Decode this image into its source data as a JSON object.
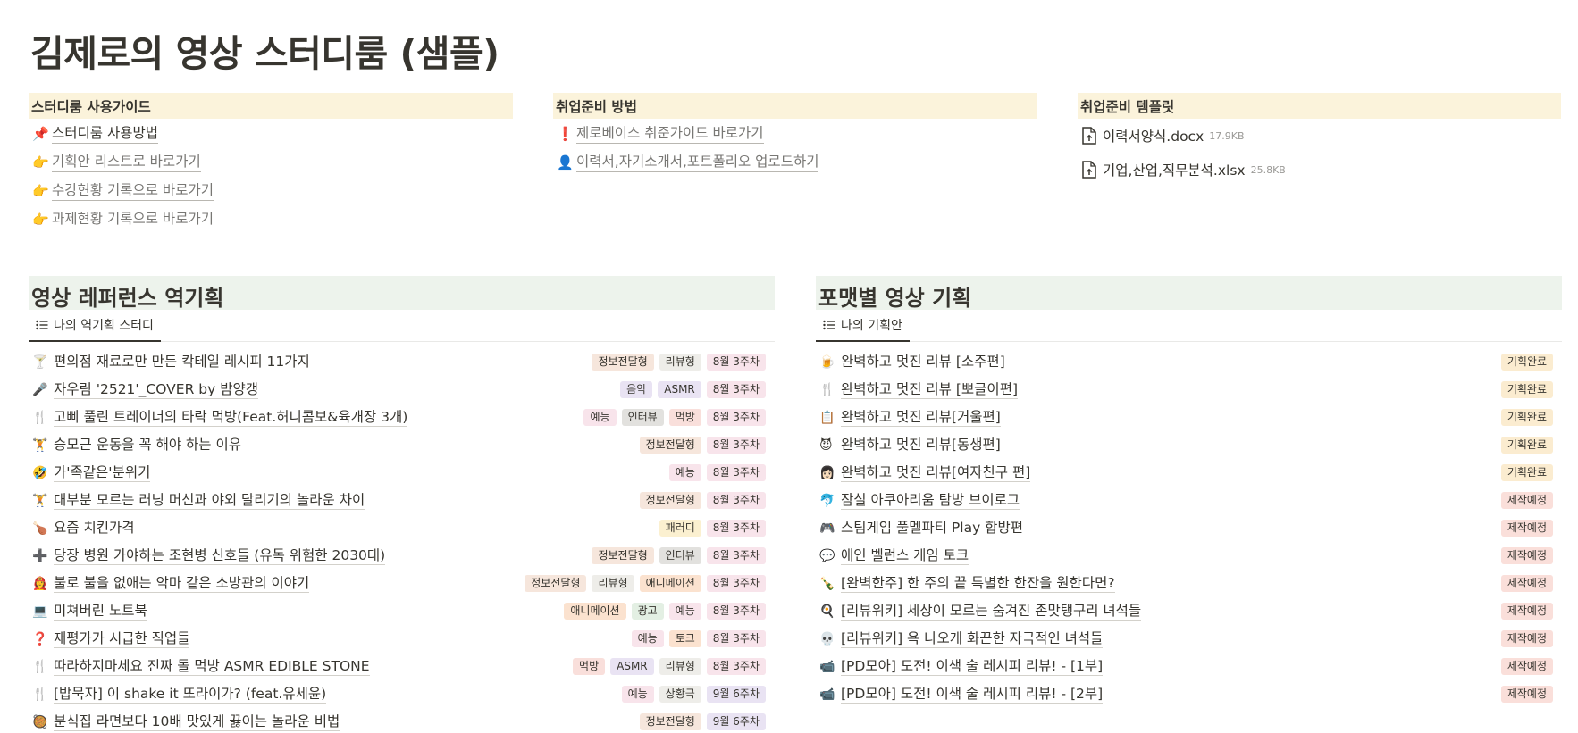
{
  "page": {
    "title": "김제로의 영상 스터디룸 (샘플)"
  },
  "guide": {
    "header": "스터디룸 사용가이드",
    "links": [
      {
        "icon": "📌",
        "icon_name": "pushpin-icon",
        "label": "스터디룸 사용방법",
        "muted": false
      },
      {
        "icon": "👉",
        "icon_name": "pointing-hand-icon",
        "label": "기획안 리스트로 바로가기",
        "muted": true
      },
      {
        "icon": "👉",
        "icon_name": "pointing-hand-icon",
        "label": "수강현황 기록으로 바로가기",
        "muted": true
      },
      {
        "icon": "👉",
        "icon_name": "pointing-hand-icon",
        "label": "과제현황 기록으로 바로가기",
        "muted": true
      }
    ]
  },
  "job": {
    "header": "취업준비 방법",
    "links": [
      {
        "icon": "❗",
        "icon_name": "exclamation-icon",
        "label": "제로베이스 취준가이드 바로가기",
        "muted": true
      },
      {
        "icon": "👤",
        "icon_name": "user-icon",
        "label": "이력서,자기소개서,포트폴리오 업로드하기",
        "muted": true
      }
    ]
  },
  "templates": {
    "header": "취업준비 템플릿",
    "files": [
      {
        "name": "이력서양식.docx",
        "size": "17.9KB",
        "icon_name": "file-upload-icon"
      },
      {
        "name": "기업,산업,직무분석.xlsx",
        "size": "25.8KB",
        "icon_name": "file-upload-icon"
      }
    ]
  },
  "colors": {
    "정보전달형": "#f6e6dc",
    "리뷰형": "#eeede9",
    "8월 3주차": "#f8e4eb",
    "9월 6주차": "#e9e3f3",
    "음악": "#e9e3f3",
    "ASMR": "#e9e3f3",
    "예능": "#f8e4eb",
    "인터뷰": "#e2e1de",
    "먹방": "#f9dfdb",
    "패러디": "#fbf0d0",
    "애니메이션": "#fbe2cf",
    "광고": "#e3efe3",
    "토크": "#fbe2cf",
    "상황극": "#eeede9",
    "기획완료": "#fbecd0",
    "제작예정": "#fadfda"
  },
  "references": {
    "header": "영상 레퍼런스 역기획",
    "view_label": "나의 역기획 스터디",
    "rows": [
      {
        "icon": "🍸",
        "title": "편의점 재료로만 만든 칵테일 레시피 11가지",
        "tags": [
          "정보전달형",
          "리뷰형",
          "8월 3주차"
        ]
      },
      {
        "icon": "🎤",
        "title": "자우림 '2521'_COVER by 밤양갱",
        "tags": [
          "음악",
          "ASMR",
          "8월 3주차"
        ]
      },
      {
        "icon": "🍴",
        "title": "고삐 풀린 트레이너의 타락 먹방(Feat.허니콤보&육개장 3개)",
        "tags": [
          "예능",
          "인터뷰",
          "먹방",
          "8월 3주차"
        ]
      },
      {
        "icon": "🏋",
        "title": "승모근 운동을 꼭 해야 하는 이유",
        "tags": [
          "정보전달형",
          "8월 3주차"
        ]
      },
      {
        "icon": "🤣",
        "title": "가'족같은'분위기",
        "tags": [
          "예능",
          "8월 3주차"
        ]
      },
      {
        "icon": "🏋",
        "title": "대부분 모르는 러닝 머신과 야외 달리기의 놀라운 차이",
        "tags": [
          "정보전달형",
          "8월 3주차"
        ]
      },
      {
        "icon": "🍗",
        "title": "요즘 치킨가격",
        "tags": [
          "패러디",
          "8월 3주차"
        ]
      },
      {
        "icon": "➕",
        "title": "당장 병원 가야하는 조현병 신호들 (유독 위험한 2030대)",
        "tags": [
          "정보전달형",
          "인터뷰",
          "8월 3주차"
        ]
      },
      {
        "icon": "👩‍🚒",
        "title": "불로 불을 없애는 악마 같은 소방관의 이야기",
        "tags": [
          "정보전달형",
          "리뷰형",
          "애니메이션",
          "8월 3주차"
        ]
      },
      {
        "icon": "💻",
        "title": "미쳐버린 노트북",
        "tags": [
          "애니메이션",
          "광고",
          "예능",
          "8월 3주차"
        ]
      },
      {
        "icon": "❓",
        "title": "재평가가 시급한 직업들",
        "tags": [
          "예능",
          "토크",
          "8월 3주차"
        ]
      },
      {
        "icon": "🍴",
        "title": "따라하지마세요 진짜 돌 먹방 ASMR EDIBLE STONE",
        "tags": [
          "먹방",
          "ASMR",
          "리뷰형",
          "8월 3주차"
        ]
      },
      {
        "icon": "🍴",
        "title": "[밥묵자] 이 shake it 또라이가? (feat.유세윤)",
        "tags": [
          "예능",
          "상황극",
          "9월 6주차"
        ]
      },
      {
        "icon": "🥘",
        "title": "분식집 라면보다 10배 맛있게 끓이는 놀라운 비법",
        "tags": [
          "정보전달형",
          "9월 6주차"
        ]
      }
    ]
  },
  "formats": {
    "header": "포맷별 영상 기획",
    "view_label": "나의 기획안",
    "rows": [
      {
        "icon": "🍺",
        "title": "완벽하고 멋진 리뷰 [소주편]",
        "tags": [
          "기획완료"
        ]
      },
      {
        "icon": "🍴",
        "title": "완벽하고 멋진 리뷰 [뽀글이편]",
        "tags": [
          "기획완료"
        ]
      },
      {
        "icon": "📋",
        "title": "완벽하고 멋진 리뷰[거울편]",
        "tags": [
          "기획완료"
        ]
      },
      {
        "icon": "😈",
        "title": "완벽하고 멋진 리뷰[동생편]",
        "tags": [
          "기획완료"
        ]
      },
      {
        "icon": "👩🏻",
        "title": "완벽하고 멋진 리뷰[여자친구 편]",
        "tags": [
          "기획완료"
        ]
      },
      {
        "icon": "🐬",
        "title": "잠실 아쿠아리움 탐방 브이로그",
        "tags": [
          "제작예정"
        ]
      },
      {
        "icon": "🎮",
        "title": "스팀게임 풀멜파티 Play 합방편",
        "tags": [
          "제작예정"
        ]
      },
      {
        "icon": "💬",
        "title": "애인 벨런스 게임 토크",
        "tags": [
          "제작예정"
        ]
      },
      {
        "icon": "🍾",
        "title": "[완벽한주] 한 주의 끝 특별한 한잔을 원한다면?",
        "tags": [
          "제작예정"
        ]
      },
      {
        "icon": "🍳",
        "title": "[리뷰위키] 세상이 모르는 숨겨진 존맛탱구리 녀석들",
        "tags": [
          "제작예정"
        ]
      },
      {
        "icon": "💀",
        "title": "[리뷰위키] 욕 나오게 화끈한 자극적인 녀석들",
        "tags": [
          "제작예정"
        ]
      },
      {
        "icon": "📹",
        "title": "[PD모아] 도전! 이색 술 레시피 리뷰! - [1부]",
        "tags": [
          "제작예정"
        ]
      },
      {
        "icon": "📹",
        "title": "[PD모아] 도전! 이색 술 레시피 리뷰! - [2부]",
        "tags": [
          "제작예정"
        ]
      }
    ]
  }
}
